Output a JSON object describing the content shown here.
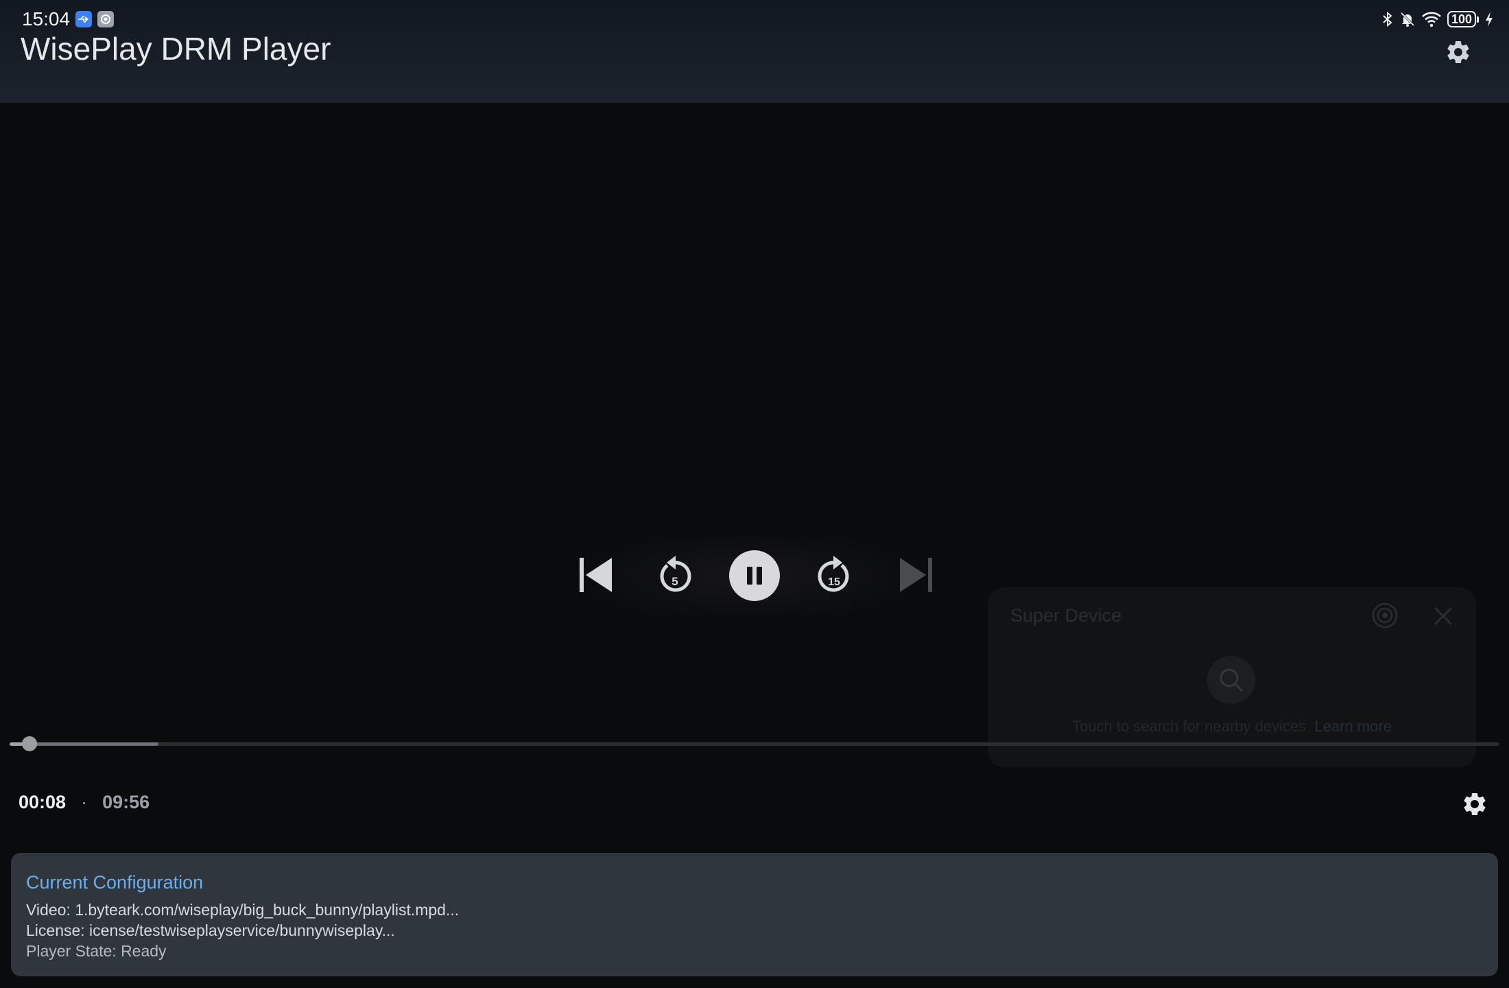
{
  "status_bar": {
    "time": "15:04",
    "battery": "100",
    "left_icons": [
      "usb-icon",
      "camera-icon"
    ],
    "right_icons": [
      "bluetooth-icon",
      "bell-off-icon",
      "wifi-icon",
      "battery-icon",
      "charging-icon"
    ]
  },
  "header": {
    "title": "WisePlay DRM Player",
    "settings_icon": "gear-icon"
  },
  "player": {
    "controls": [
      "skip-previous-icon",
      "rewind-5-icon",
      "pause-icon",
      "forward-15-icon",
      "skip-next-icon"
    ],
    "rewind_seconds": "5",
    "forward_seconds": "15",
    "current_time": "00:08",
    "separator": "·",
    "duration": "09:56",
    "progress_fraction": 0.0134,
    "buffered_fraction": 0.1
  },
  "super_device": {
    "title": "Super Device",
    "hint": "Touch to search for nearby devices.",
    "learn_more": "Learn more"
  },
  "config": {
    "title": "Current Configuration",
    "video": "Video: 1.byteark.com/wiseplay/big_buck_bunny/playlist.mpd...",
    "license": "License: icense/testwiseplayservice/bunnywiseplay...",
    "state": "Player State: Ready"
  },
  "colors": {
    "accent": "#6aaeea",
    "panel": "#2f363d",
    "background": "#0a0b0d"
  }
}
